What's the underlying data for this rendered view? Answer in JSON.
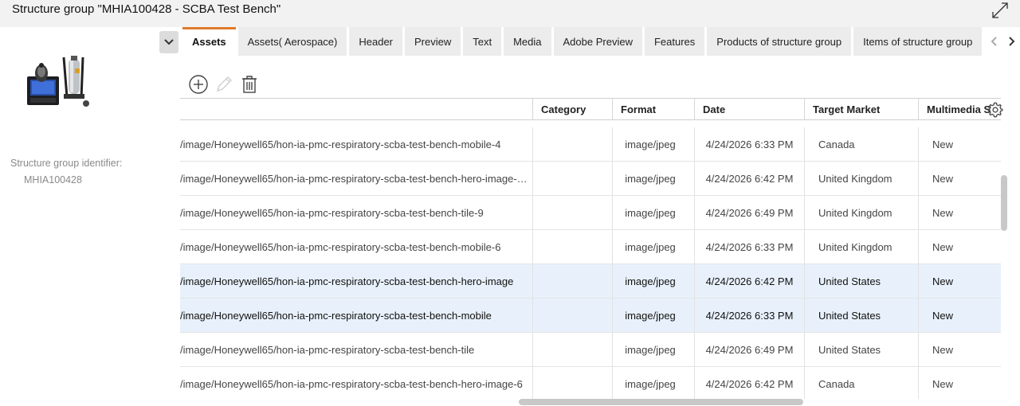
{
  "window": {
    "title": "Structure group \"MHIA100428 - SCBA Test Bench\""
  },
  "left_panel": {
    "identifier_label": "Structure group identifier:",
    "identifier_value": "MHIA100428"
  },
  "tabs": [
    {
      "label": "Assets",
      "active": true
    },
    {
      "label": "Assets( Aerospace)"
    },
    {
      "label": "Header"
    },
    {
      "label": "Preview"
    },
    {
      "label": "Text"
    },
    {
      "label": "Media"
    },
    {
      "label": "Adobe Preview"
    },
    {
      "label": "Features"
    },
    {
      "label": "Products of structure group"
    },
    {
      "label": "Items of structure group"
    }
  ],
  "table": {
    "columns": [
      "Category",
      "Format",
      "Date",
      "Target Market",
      "Multimedia S"
    ],
    "rows": [
      {
        "path": "/image/Honeywell65/hon-ia-pmc-respiratory-scba-test-bench-mobile-4",
        "category": "",
        "format": "image/jpeg",
        "date": "4/24/2026 6:33 PM",
        "market": "Canada",
        "status": "New",
        "selected": false
      },
      {
        "path": "/image/Honeywell65/hon-ia-pmc-respiratory-scba-test-bench-hero-image-…",
        "category": "",
        "format": "image/jpeg",
        "date": "4/24/2026 6:42 PM",
        "market": "United Kingdom",
        "status": "New",
        "selected": false
      },
      {
        "path": "/image/Honeywell65/hon-ia-pmc-respiratory-scba-test-bench-tile-9",
        "category": "",
        "format": "image/jpeg",
        "date": "4/24/2026 6:49 PM",
        "market": "United Kingdom",
        "status": "New",
        "selected": false
      },
      {
        "path": "/image/Honeywell65/hon-ia-pmc-respiratory-scba-test-bench-mobile-6",
        "category": "",
        "format": "image/jpeg",
        "date": "4/24/2026 6:33 PM",
        "market": "United Kingdom",
        "status": "New",
        "selected": false
      },
      {
        "path": "/image/Honeywell65/hon-ia-pmc-respiratory-scba-test-bench-hero-image",
        "category": "",
        "format": "image/jpeg",
        "date": "4/24/2026 6:42 PM",
        "market": "United States",
        "status": "New",
        "selected": true
      },
      {
        "path": "/image/Honeywell65/hon-ia-pmc-respiratory-scba-test-bench-mobile",
        "category": "",
        "format": "image/jpeg",
        "date": "4/24/2026 6:33 PM",
        "market": "United States",
        "status": "New",
        "selected": true
      },
      {
        "path": "/image/Honeywell65/hon-ia-pmc-respiratory-scba-test-bench-tile",
        "category": "",
        "format": "image/jpeg",
        "date": "4/24/2026 6:49 PM",
        "market": "United States",
        "status": "New",
        "selected": false
      },
      {
        "path": "/image/Honeywell65/hon-ia-pmc-respiratory-scba-test-bench-hero-image-6",
        "category": "",
        "format": "image/jpeg",
        "date": "4/24/2026 6:42 PM",
        "market": "Canada",
        "status": "New",
        "selected": false
      }
    ]
  },
  "icons": {
    "expand": "expand-icon",
    "collapse": "chevron-down-icon",
    "tab_prev": "chevron-left-icon",
    "tab_next": "chevron-right-icon",
    "add": "add-circle-icon",
    "edit": "pencil-icon",
    "delete": "trash-icon",
    "settings": "gear-icon"
  },
  "colors": {
    "active_tab_accent": "#e07a2a",
    "selected_row": "#e8f1fb"
  }
}
